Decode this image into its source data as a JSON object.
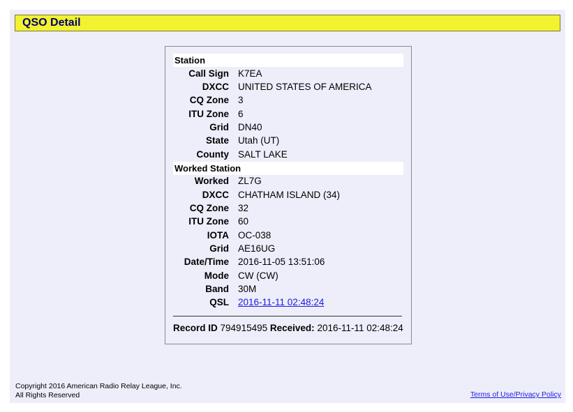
{
  "header": {
    "title": "QSO Detail"
  },
  "station": {
    "heading": "Station",
    "fields": [
      {
        "label": "Call Sign",
        "value": "K7EA"
      },
      {
        "label": "DXCC",
        "value": "UNITED STATES OF AMERICA"
      },
      {
        "label": "CQ Zone",
        "value": "3"
      },
      {
        "label": "ITU Zone",
        "value": "6"
      },
      {
        "label": "Grid",
        "value": "DN40"
      },
      {
        "label": "State",
        "value": "Utah (UT)"
      },
      {
        "label": "County",
        "value": "SALT LAKE"
      }
    ]
  },
  "worked": {
    "heading": "Worked Station",
    "fields": [
      {
        "label": "Worked",
        "value": "ZL7G"
      },
      {
        "label": "DXCC",
        "value": "CHATHAM ISLAND (34)"
      },
      {
        "label": "CQ Zone",
        "value": "32"
      },
      {
        "label": "ITU Zone",
        "value": "60"
      },
      {
        "label": "IOTA",
        "value": "OC-038"
      },
      {
        "label": "Grid",
        "value": "AE16UG"
      },
      {
        "label": "Date/Time",
        "value": "2016-11-05 13:51:06"
      },
      {
        "label": "Mode",
        "value": "CW (CW)"
      },
      {
        "label": "Band",
        "value": "30M"
      },
      {
        "label": "QSL",
        "value": "2016-11-11 02:48:24"
      }
    ]
  },
  "record": {
    "id_label": "Record ID",
    "id_value": "794915495",
    "received_label": "Received:",
    "received_value": "2016-11-11 02:48:24"
  },
  "footer": {
    "copyright_line1": "Copyright 2016 American Radio Relay League, Inc.",
    "copyright_line2": "All Rights Reserved",
    "terms_link": "Terms of Use/Privacy Policy"
  }
}
